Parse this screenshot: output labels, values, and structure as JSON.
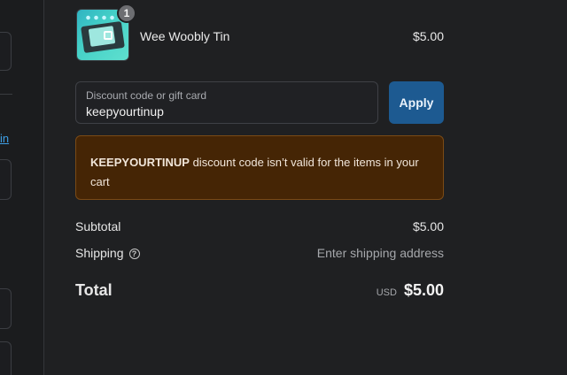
{
  "left_panel": {
    "link_text": "in"
  },
  "product": {
    "name": "Wee Woobly Tin",
    "price": "$5.00",
    "quantity": "1",
    "image_icon": "product-thumbnail"
  },
  "discount": {
    "label": "Discount code or gift card",
    "value": "keepyourtinup",
    "apply_label": "Apply"
  },
  "error": {
    "code": "KEEPYOURTINUP",
    "message": " discount code isn’t valid for the items in your cart",
    "background": "#452505"
  },
  "summary": {
    "subtotal_label": "Subtotal",
    "subtotal_value": "$5.00",
    "shipping_label": "Shipping",
    "shipping_value": "Enter shipping address",
    "help_icon": "?",
    "total_label": "Total",
    "currency": "USD",
    "total_value": "$5.00"
  },
  "colors": {
    "accent": "#1d5a91",
    "background": "#1f2022"
  }
}
